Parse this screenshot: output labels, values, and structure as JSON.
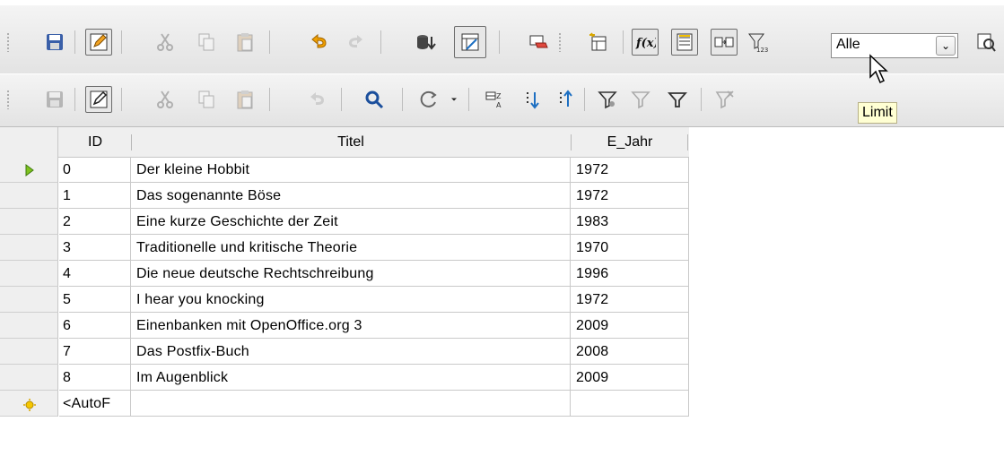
{
  "toolbar1": {
    "buttons": [
      "save-icon",
      "edit-icon",
      "cut-icon",
      "copy-icon",
      "paste-icon",
      "undo-icon",
      "redo-icon",
      "run-query-icon",
      "design-view-icon",
      "clear-query-icon",
      "add-table-icon",
      "functions-icon",
      "table-name-icon",
      "alias-icon",
      "limit-icon"
    ],
    "limit_value": "Alle",
    "limit_tooltip": "Limit"
  },
  "toolbar2": {
    "buttons": [
      "save-record-icon",
      "edit-data-icon",
      "cut-icon",
      "copy-icon",
      "paste-icon",
      "undo-icon",
      "find-record-icon",
      "refresh-icon",
      "refresh-dropdown-icon",
      "sort-icon",
      "sort-ascending-icon",
      "sort-descending-icon",
      "autofilter-icon",
      "apply-filter-icon",
      "standard-filter-icon",
      "reset-filter-icon"
    ]
  },
  "grid": {
    "columns": [
      "ID",
      "Titel",
      "E_Jahr"
    ],
    "rows": [
      {
        "id": "0",
        "titel": "Der kleine Hobbit",
        "jahr": "1972"
      },
      {
        "id": "1",
        "titel": "Das sogenannte Böse",
        "jahr": "1972"
      },
      {
        "id": "2",
        "titel": "Eine kurze Geschichte der Zeit",
        "jahr": "1983"
      },
      {
        "id": "3",
        "titel": "Traditionelle und kritische Theorie",
        "jahr": "1970"
      },
      {
        "id": "4",
        "titel": "Die neue deutsche Rechtschreibung",
        "jahr": "1996"
      },
      {
        "id": "5",
        "titel": "I hear you knocking",
        "jahr": "1972"
      },
      {
        "id": "6",
        "titel": "Einenbanken mit OpenOffice.org 3",
        "jahr": "2009"
      },
      {
        "id": "7",
        "titel": "Das Postfix-Buch",
        "jahr": "2008"
      },
      {
        "id": "8",
        "titel": "Im Augenblick",
        "jahr": "2009"
      }
    ],
    "new_row": {
      "id": "<AutoF",
      "titel": "",
      "jahr": ""
    }
  }
}
